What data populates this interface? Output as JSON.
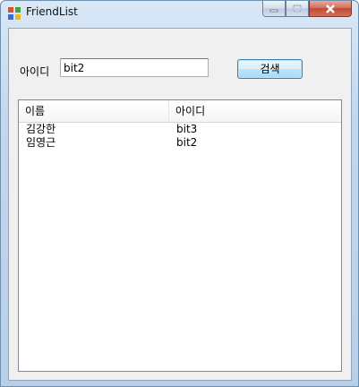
{
  "window": {
    "title": "FriendList"
  },
  "form": {
    "id_label": "아이디",
    "id_value": "bit2",
    "search_button": "검색"
  },
  "list": {
    "columns": [
      "이름",
      "아이디"
    ],
    "rows": [
      {
        "name": "김강한",
        "id": "bit3"
      },
      {
        "name": "임영근",
        "id": "bit2"
      }
    ]
  }
}
